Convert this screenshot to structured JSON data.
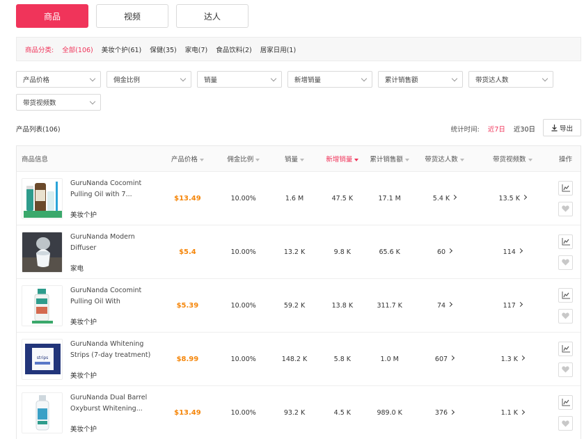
{
  "tabs": [
    {
      "label": "商品",
      "active": true
    },
    {
      "label": "视频",
      "active": false
    },
    {
      "label": "达人",
      "active": false
    }
  ],
  "category_bar": {
    "title": "商品分类:",
    "items": [
      {
        "label": "全部(106)",
        "active": true
      },
      {
        "label": "美妆个护(61)",
        "active": false
      },
      {
        "label": "保健(35)",
        "active": false
      },
      {
        "label": "家电(7)",
        "active": false
      },
      {
        "label": "食品饮料(2)",
        "active": false
      },
      {
        "label": "居家日用(1)",
        "active": false
      }
    ]
  },
  "filters": [
    "产品价格",
    "佣金比例",
    "销量",
    "新增销量",
    "累计销售额",
    "带货达人数",
    "带货视频数"
  ],
  "list": {
    "title": "产品列表(106)",
    "time_label": "统计时间:",
    "time_options": [
      {
        "label": "近7日",
        "active": true
      },
      {
        "label": "近30日",
        "active": false
      }
    ],
    "export_label": "导出"
  },
  "table": {
    "headers": [
      "商品信息",
      "产品价格",
      "佣金比例",
      "销量",
      "新增销量",
      "累计销售额",
      "带货达人数",
      "带货视频数",
      "操作"
    ],
    "rows": [
      {
        "name": "GuruNanda Cocomint Pulling Oil with 7...",
        "category": "美妆个护",
        "price": "$13.49",
        "commission": "10.00%",
        "sales": "1.6 M",
        "new_sales": "47.5 K",
        "total_sales": "17.1 M",
        "creators": "5.4 K",
        "videos": "13.5 K",
        "thumb": "oil-bottle"
      },
      {
        "name": "GuruNanda Modern Diffuser",
        "category": "家电",
        "price": "$5.4",
        "commission": "10.00%",
        "sales": "13.2 K",
        "new_sales": "9.8 K",
        "total_sales": "65.6 K",
        "creators": "60",
        "videos": "114",
        "thumb": "diffuser"
      },
      {
        "name": "GuruNanda Cocomint Pulling Oil With Essenti...",
        "category": "美妆个护",
        "price": "$5.39",
        "commission": "10.00%",
        "sales": "59.2 K",
        "new_sales": "13.8 K",
        "total_sales": "311.7 K",
        "creators": "74",
        "videos": "117",
        "thumb": "small-bottle"
      },
      {
        "name": "GuruNanda Whitening Strips (7-day treatment)",
        "category": "美妆个护",
        "price": "$8.99",
        "commission": "10.00%",
        "sales": "148.2 K",
        "new_sales": "5.8 K",
        "total_sales": "1.0 M",
        "creators": "607",
        "videos": "1.3 K",
        "thumb": "strips-box"
      },
      {
        "name": "GuruNanda Dual Barrel Oxyburst Whitening...",
        "category": "美妆个护",
        "price": "$13.49",
        "commission": "10.00%",
        "sales": "93.2 K",
        "new_sales": "4.5 K",
        "total_sales": "989.0 K",
        "creators": "376",
        "videos": "1.1 K",
        "thumb": "spray-bottle"
      }
    ]
  },
  "colors": {
    "accent": "#f0345a",
    "price": "#f5860a"
  }
}
